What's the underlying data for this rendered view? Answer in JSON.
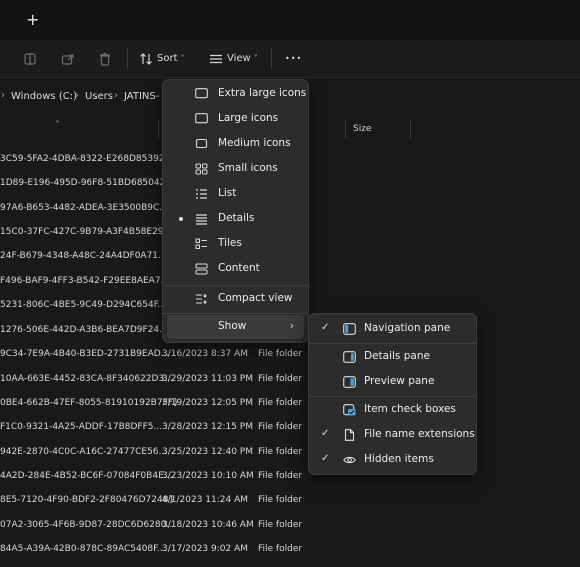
{
  "titlebar": {
    "new_tab_glyph": "+"
  },
  "toolbar": {
    "sort_label": "Sort",
    "view_label": "View",
    "more_glyph": "•••",
    "chevron": "˅"
  },
  "address": {
    "segments": [
      "Windows (C:)",
      "Users",
      "JATINS-"
    ],
    "separator": "›"
  },
  "columns": {
    "size": "Size",
    "sort_caret": "˄"
  },
  "rows": [
    {
      "name": "3C59-5FA2-4DBA-8322-E268D85392...",
      "date": "",
      "type": ""
    },
    {
      "name": "1D89-E196-495D-96F8-51BD685042...",
      "date": "",
      "type": ""
    },
    {
      "name": "97A6-B653-4482-ADEA-3E3500B9C...",
      "date": "",
      "type": ""
    },
    {
      "name": "15C0-37FC-427C-9B79-A3F4B58E29...",
      "date": "",
      "type": ""
    },
    {
      "name": "24F-B679-4348-A48C-24A4DF0A71...",
      "date": "",
      "type": ""
    },
    {
      "name": "F496-BAF9-4FF3-B542-F29EE8AEA7...",
      "date": "",
      "type": ""
    },
    {
      "name": "5231-806C-4BE5-9C49-D294C654F...",
      "date": "",
      "type": ""
    },
    {
      "name": "1276-506E-442D-A3B6-BEA7D9F24...",
      "date": "",
      "type": ""
    },
    {
      "name": "9C34-7E9A-4B40-B3ED-2731B9EAD...",
      "date": "3/16/2023 8:37 AM",
      "type": "File folder"
    },
    {
      "name": "10AA-663E-4452-83CA-8F340622D3...",
      "date": "3/29/2023 11:03 PM",
      "type": "File folder"
    },
    {
      "name": "0BE4-662B-47EF-8055-81910192B7FF}",
      "date": "3/19/2023 12:05 PM",
      "type": "File folder"
    },
    {
      "name": "F1C0-9321-4A25-ADDF-17B8DFF5...",
      "date": "3/28/2023 12:15 PM",
      "type": "File folder"
    },
    {
      "name": "942E-2870-4C0C-A16C-27477CE56...",
      "date": "3/25/2023 12:40 PM",
      "type": "File folder"
    },
    {
      "name": "4A2D-284E-4B52-BC6F-07084F0B4E...",
      "date": "3/23/2023 10:10 AM",
      "type": "File folder"
    },
    {
      "name": "8E5-7120-4F90-BDF2-2F80476D7248}",
      "date": "4/1/2023 11:24 AM",
      "type": "File folder"
    },
    {
      "name": "07A2-3065-4F6B-9D87-28DC6D6280...",
      "date": "3/18/2023 10:46 AM",
      "type": "File folder"
    },
    {
      "name": "84A5-A39A-42B0-878C-89AC5408F...",
      "date": "3/17/2023 9:02 AM",
      "type": "File folder"
    }
  ],
  "view_menu": {
    "items": [
      {
        "label": "Extra large icons",
        "icon": "monitor-icon",
        "selected": false
      },
      {
        "label": "Large icons",
        "icon": "monitor-icon",
        "selected": false
      },
      {
        "label": "Medium icons",
        "icon": "monitor-icon",
        "selected": false
      },
      {
        "label": "Small icons",
        "icon": "grid-icon",
        "selected": false
      },
      {
        "label": "List",
        "icon": "list-icon",
        "selected": false
      },
      {
        "label": "Details",
        "icon": "details-icon",
        "selected": true
      },
      {
        "label": "Tiles",
        "icon": "tiles-icon",
        "selected": false
      },
      {
        "label": "Content",
        "icon": "content-icon",
        "selected": false
      },
      {
        "label": "Compact view",
        "icon": "compact-icon",
        "selected": false
      },
      {
        "label": "Show",
        "icon": "",
        "selected": false,
        "has_submenu": true
      }
    ],
    "submenu_arrow": "›"
  },
  "show_menu": {
    "items": [
      {
        "label": "Navigation pane",
        "icon": "navigation-pane-icon",
        "checked": true
      },
      {
        "label": "Details pane",
        "icon": "details-pane-icon",
        "checked": false
      },
      {
        "label": "Preview pane",
        "icon": "preview-pane-icon",
        "checked": false
      },
      {
        "label": "Item check boxes",
        "icon": "checkbox-icon",
        "checked": false
      },
      {
        "label": "File name extensions",
        "icon": "file-icon",
        "checked": true
      },
      {
        "label": "Hidden items",
        "icon": "eye-icon",
        "checked": true
      }
    ],
    "check_glyph": "✓"
  },
  "colors": {
    "background": "#191919",
    "menu": "#2c2c2c",
    "accent": "#4aa3e0"
  }
}
